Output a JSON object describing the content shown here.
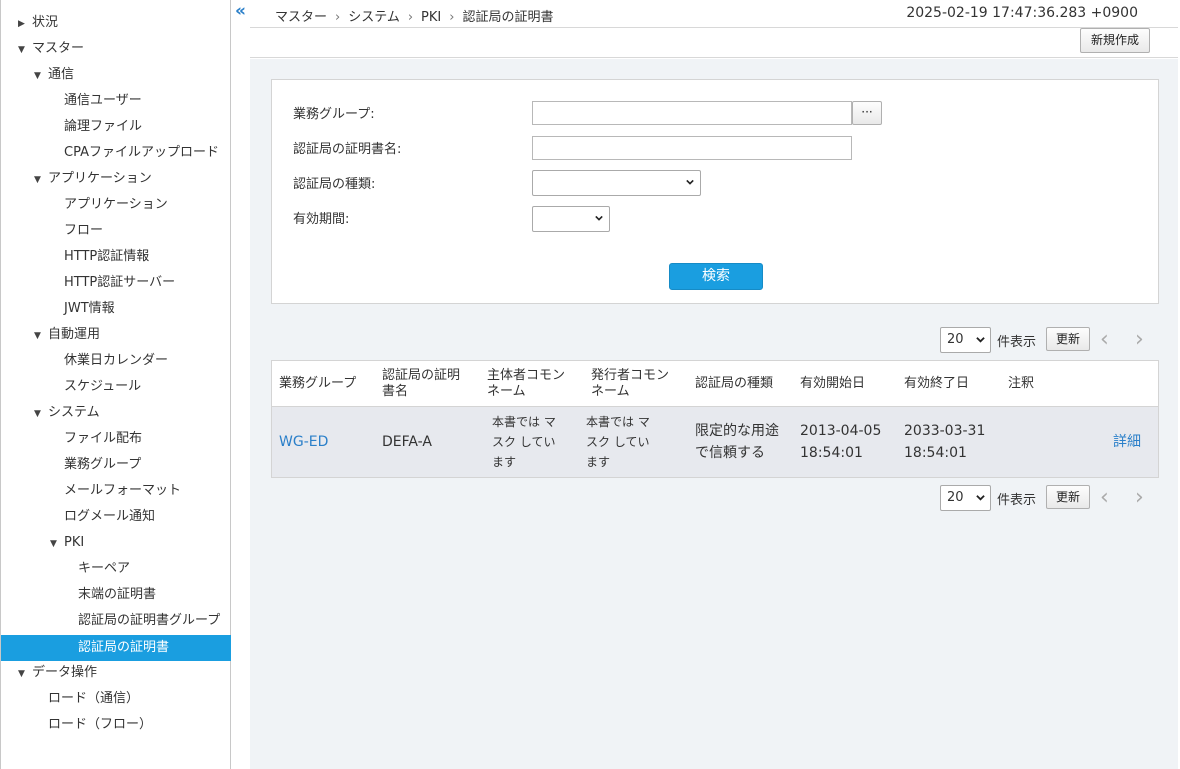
{
  "sidebar": {
    "items": [
      {
        "label": "状況",
        "arrow": "▶"
      },
      {
        "label": "マスター",
        "arrow": "▼"
      },
      {
        "label": "通信",
        "arrow": "▼"
      },
      {
        "label": "通信ユーザー",
        "arrow": ""
      },
      {
        "label": "論理ファイル",
        "arrow": ""
      },
      {
        "label": "CPAファイルアップロード",
        "arrow": ""
      },
      {
        "label": "アプリケーション",
        "arrow": "▼"
      },
      {
        "label": "アプリケーション",
        "arrow": ""
      },
      {
        "label": "フロー",
        "arrow": ""
      },
      {
        "label": "HTTP認証情報",
        "arrow": ""
      },
      {
        "label": "HTTP認証サーバー",
        "arrow": ""
      },
      {
        "label": "JWT情報",
        "arrow": ""
      },
      {
        "label": "自動運用",
        "arrow": "▼"
      },
      {
        "label": "休業日カレンダー",
        "arrow": ""
      },
      {
        "label": "スケジュール",
        "arrow": ""
      },
      {
        "label": "システム",
        "arrow": "▼"
      },
      {
        "label": "ファイル配布",
        "arrow": ""
      },
      {
        "label": "業務グループ",
        "arrow": ""
      },
      {
        "label": "メールフォーマット",
        "arrow": ""
      },
      {
        "label": "ログメール通知",
        "arrow": ""
      },
      {
        "label": "PKI",
        "arrow": "▼"
      },
      {
        "label": "キーペア",
        "arrow": ""
      },
      {
        "label": "末端の証明書",
        "arrow": ""
      },
      {
        "label": "認証局の証明書グループ",
        "arrow": ""
      },
      {
        "label": "認証局の証明書",
        "arrow": ""
      },
      {
        "label": "データ操作",
        "arrow": "▼"
      },
      {
        "label": "ロード（通信）",
        "arrow": ""
      },
      {
        "label": "ロード（フロー）",
        "arrow": ""
      }
    ],
    "collapse_icon": "«"
  },
  "header": {
    "breadcrumb": [
      "マスター",
      "システム",
      "PKI",
      "認証局の証明書"
    ],
    "separator": "›",
    "timestamp": "2025-02-19 17:47:36.283 +0900"
  },
  "toolbar": {
    "new_label": "新規作成"
  },
  "search": {
    "group_label": "業務グループ:",
    "group_value": "",
    "browse_label": "···",
    "cert_name_label": "認証局の証明書名:",
    "cert_name_value": "",
    "ca_type_label": "認証局の種類:",
    "ca_type_value": "",
    "validity_label": "有効期間:",
    "validity_value": "",
    "search_label": "検索"
  },
  "pager": {
    "per_page": "20",
    "per_page_suffix": "件表示",
    "refresh_label": "更新",
    "prev_icon": "‹",
    "next_icon": "›"
  },
  "table": {
    "headers": [
      "業務グループ",
      "認証局の証明書名",
      "主体者コモンネーム",
      "発行者コモンネーム",
      "認証局の種類",
      "有効開始日",
      "有効終了日",
      "注釈"
    ],
    "rows": [
      {
        "group": "WG-ED",
        "cert_name": "DEFA-A",
        "subject_cn": "本書では マスク しています",
        "issuer_cn": "本書では マスク しています",
        "ca_type": "限定的な用途で信頼する",
        "start_date": "2013-04-05",
        "start_time": "18:54:01",
        "end_date": "2033-03-31",
        "end_time": "18:54:01",
        "note": "",
        "detail": "詳細"
      }
    ]
  },
  "colors": {
    "accent": "#1a9ee0",
    "link": "#2a7fc9",
    "background": "#f0f3f6"
  }
}
